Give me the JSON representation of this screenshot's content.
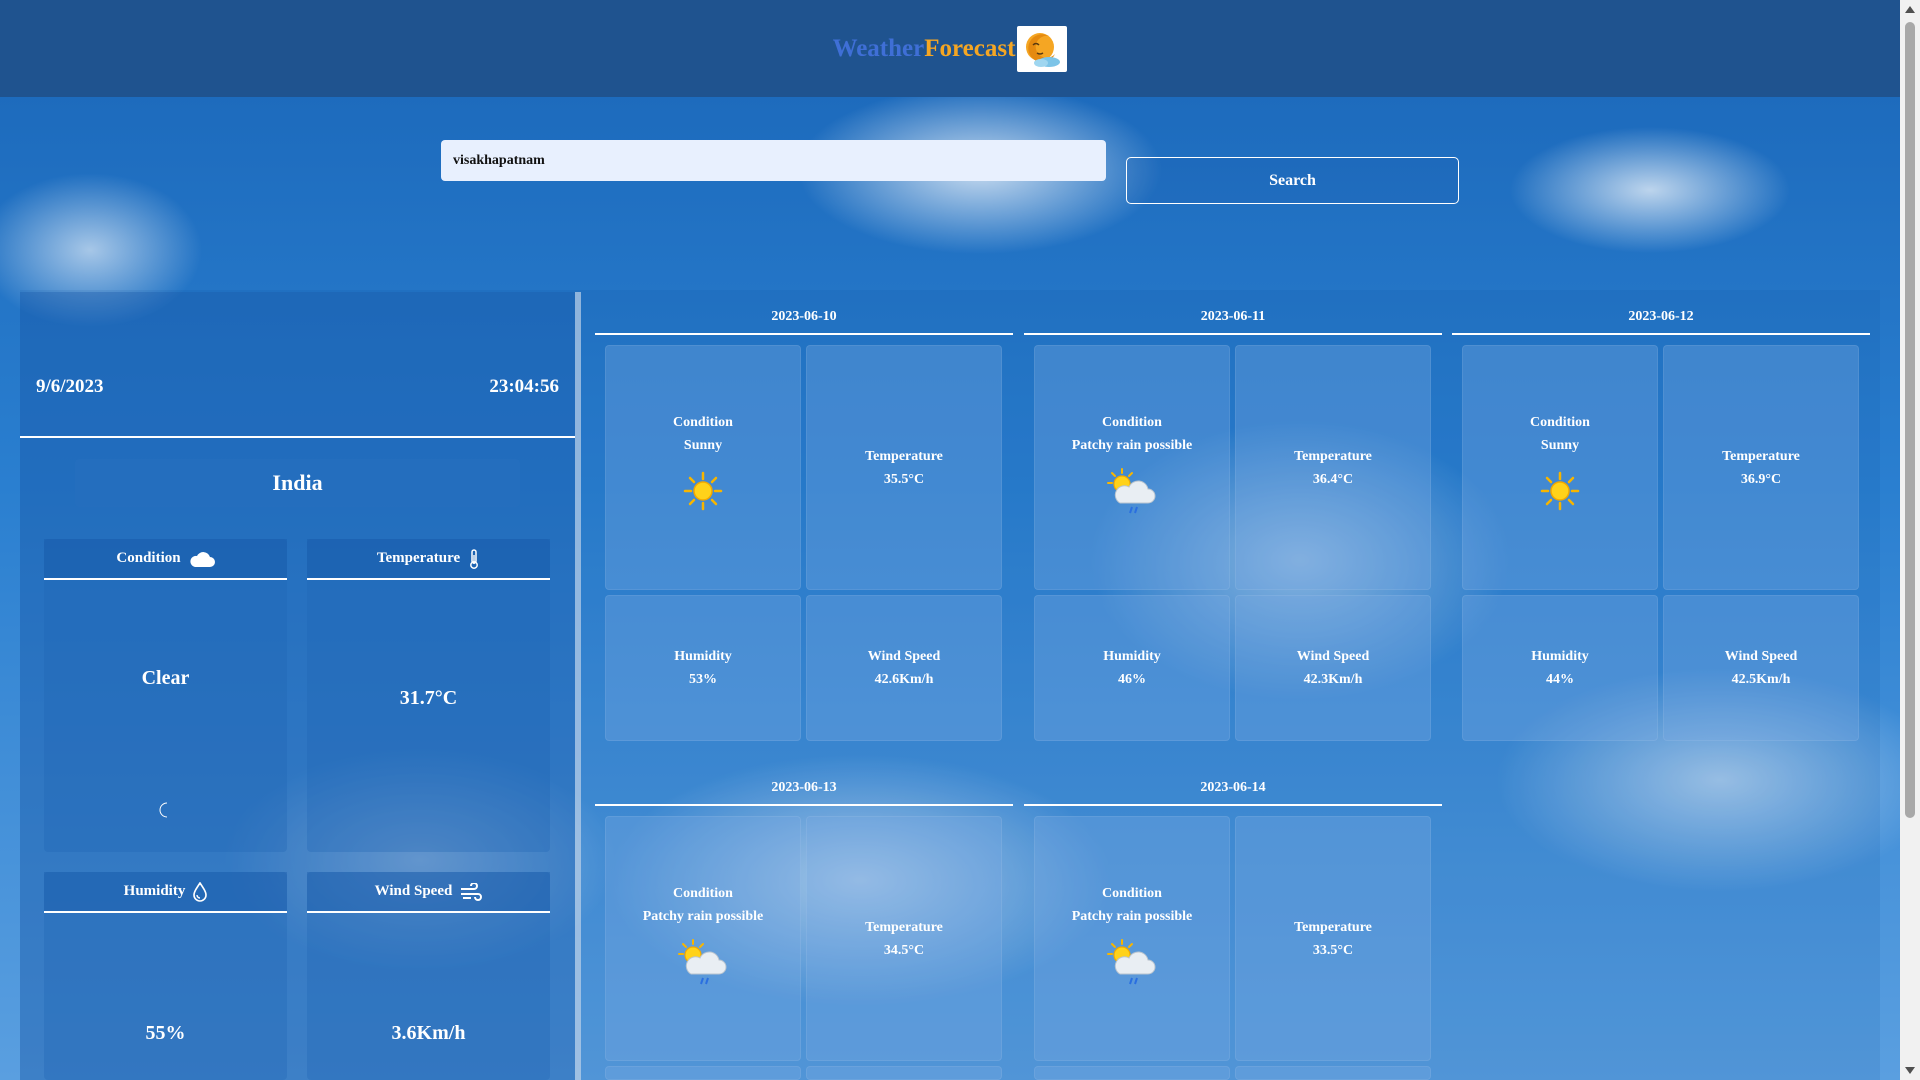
{
  "header": {
    "brand_part1": "Weather",
    "brand_part2": "Forecast",
    "logo_icon": "sun-moon-logo-icon"
  },
  "search": {
    "value": "visakhapatnam",
    "button_label": "Search"
  },
  "current": {
    "date": "9/6/2023",
    "time": "23:04:56",
    "country": "India",
    "condition_label": "Condition",
    "condition_value": "Clear",
    "condition_icon": "cloud-icon",
    "condition_state_icon": "crescent-moon-icon",
    "temperature_label": "Temperature",
    "temperature_value": "31.7°C",
    "temperature_icon": "thermometer-icon",
    "humidity_label": "Humidity",
    "humidity_value": "55%",
    "humidity_icon": "droplet-icon",
    "wind_label": "Wind Speed",
    "wind_value": "3.6Km/h",
    "wind_icon": "wind-icon"
  },
  "forecast": [
    {
      "date": "2023-06-10",
      "condition_label": "Condition",
      "condition": "Sunny",
      "icon": "sun-icon",
      "temperature_label": "Temperature",
      "temperature": "35.5°C",
      "humidity_label": "Humidity",
      "humidity": "53%",
      "wind_label": "Wind Speed",
      "wind": "42.6Km/h"
    },
    {
      "date": "2023-06-11",
      "condition_label": "Condition",
      "condition": "Patchy rain possible",
      "icon": "sun-cloud-rain-icon",
      "temperature_label": "Temperature",
      "temperature": "36.4°C",
      "humidity_label": "Humidity",
      "humidity": "46%",
      "wind_label": "Wind Speed",
      "wind": "42.3Km/h"
    },
    {
      "date": "2023-06-12",
      "condition_label": "Condition",
      "condition": "Sunny",
      "icon": "sun-icon",
      "temperature_label": "Temperature",
      "temperature": "36.9°C",
      "humidity_label": "Humidity",
      "humidity": "44%",
      "wind_label": "Wind Speed",
      "wind": "42.5Km/h"
    },
    {
      "date": "2023-06-13",
      "condition_label": "Condition",
      "condition": "Patchy rain possible",
      "icon": "sun-cloud-rain-icon",
      "temperature_label": "Temperature",
      "temperature": "34.5°C"
    },
    {
      "date": "2023-06-14",
      "condition_label": "Condition",
      "condition": "Patchy rain possible",
      "icon": "sun-cloud-rain-icon",
      "temperature_label": "Temperature",
      "temperature": "33.5°C"
    }
  ],
  "colors": {
    "header_bg": "#1f538f",
    "brand_weather": "#3f6fd6",
    "brand_forecast": "#f5a623"
  }
}
